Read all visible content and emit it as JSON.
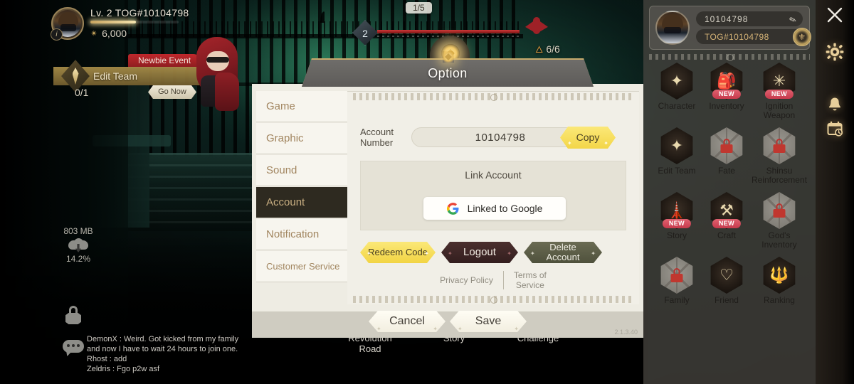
{
  "game": {
    "player": {
      "level_label": "Lv. 2",
      "name": "TOG#10104798",
      "gold": "6,000",
      "gold_icon": "star-icon",
      "info_icon": "info-icon",
      "avatar_icon": "avatar"
    },
    "event": {
      "tag": "Newbie Event",
      "title": "Edit Team",
      "progress": "0/1",
      "cta": "Go Now"
    },
    "stage": {
      "wave_count": "1/5",
      "boss_level": "2",
      "boss_hp": "6/6",
      "boss_hp_icon": "flame-icon",
      "hp_percent": 100
    },
    "download": {
      "size": "803 MB",
      "percent": "14.2%",
      "icon": "cloud-download-icon"
    },
    "chat": {
      "lock_icon": "lock-icon",
      "chat_icon": "chat-bubble-icon",
      "messages": [
        "DemonX : Weird. Got kicked from my family",
        "and now I have to wait 24 hours to join one.",
        "Rhost : add",
        "Zeldris : Fgo p2w asf"
      ]
    },
    "bottom_menu": [
      {
        "label": "Revolution\nRoad",
        "icon": "revolution-road-icon"
      },
      {
        "label": "Story",
        "icon": "story-book-icon"
      },
      {
        "label": "Challenge",
        "icon": "challenge-wings-icon"
      }
    ]
  },
  "dialog": {
    "title": "Option",
    "version": "2.1.3.40",
    "tabs": [
      {
        "label": "Game",
        "active": false
      },
      {
        "label": "Graphic",
        "active": false
      },
      {
        "label": "Sound",
        "active": false
      },
      {
        "label": "Account",
        "active": true
      },
      {
        "label": "Notification",
        "active": false
      },
      {
        "label": "Customer Service",
        "active": false
      }
    ],
    "account": {
      "number_label": "Account\nNumber",
      "number_value": "10104798",
      "copy_label": "Copy",
      "link_title": "Link Account",
      "google_label": "Linked to Google",
      "google_icon": "google-logo-icon",
      "redeem_label": "Redeem Code",
      "logout_label": "Logout",
      "delete_label": "Delete\nAccount",
      "privacy_label": "Privacy Policy",
      "terms_label": "Terms of\nService"
    },
    "footer": {
      "cancel_label": "Cancel",
      "save_label": "Save"
    }
  },
  "sidebar": {
    "profile": {
      "nickname": "10104798",
      "tag": "TOG#10104798",
      "edit_icon": "pencil-icon",
      "emblem_icon": "guild-emblem-icon",
      "avatar_icon": "avatar"
    },
    "new_badge": "NEW",
    "menu": [
      {
        "label": "Character",
        "icon": "sparkle-icon",
        "locked": false,
        "badge": ""
      },
      {
        "label": "Inventory",
        "icon": "backpack-icon",
        "locked": false,
        "badge": "NEW"
      },
      {
        "label": "Ignition\nWeapon",
        "icon": "ignition-icon",
        "locked": false,
        "badge": "NEW"
      },
      {
        "label": "Edit Team",
        "icon": "sparkles-icon",
        "locked": false,
        "badge": ""
      },
      {
        "label": "Fate",
        "icon": "lock-icon",
        "locked": true,
        "badge": ""
      },
      {
        "label": "Shinsu\nReinforcement",
        "icon": "lock-icon",
        "locked": true,
        "badge": ""
      },
      {
        "label": "Story",
        "icon": "tower-icon",
        "locked": false,
        "badge": "NEW"
      },
      {
        "label": "Craft",
        "icon": "anvil-icon",
        "locked": false,
        "badge": "NEW"
      },
      {
        "label": "God's Inventory",
        "icon": "lock-icon",
        "locked": true,
        "badge": ""
      },
      {
        "label": "Family",
        "icon": "lock-icon",
        "locked": true,
        "badge": ""
      },
      {
        "label": "Friend",
        "icon": "heart-wing-icon",
        "locked": false,
        "badge": ""
      },
      {
        "label": "Ranking",
        "icon": "trident-icon",
        "locked": false,
        "badge": ""
      }
    ],
    "rail": [
      {
        "icon": "close-icon"
      },
      {
        "icon": "gear-icon"
      },
      {
        "icon": "bell-icon"
      },
      {
        "icon": "calendar-clock-icon"
      }
    ]
  },
  "colors": {
    "accent_gold": "#c7ab6d",
    "yellow_button": "#f3d648",
    "logout_dark": "#3a2322",
    "delete_olive": "#5a5c45",
    "badge_red": "#c63a4c",
    "tab_active_bg": "#2e2a20",
    "tab_text": "#a1855f",
    "dialog_bg": "#eeece3",
    "panel_bg": "#e5e2d6"
  }
}
